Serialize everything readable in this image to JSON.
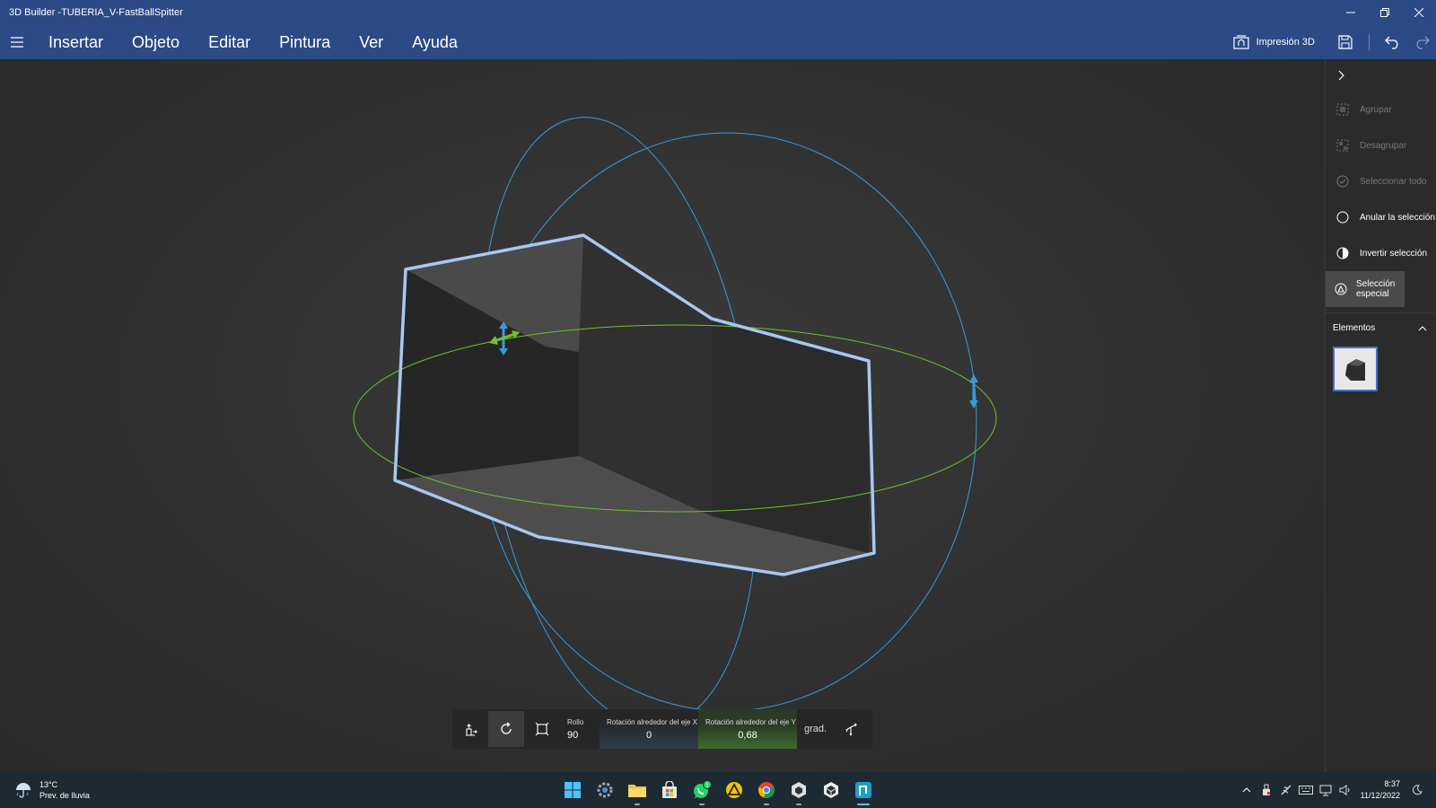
{
  "window": {
    "title": "3D Builder -TUBERIA_V-FastBallSpitter"
  },
  "menu": {
    "items": [
      {
        "label": "Insertar"
      },
      {
        "label": "Objeto"
      },
      {
        "label": "Editar"
      },
      {
        "label": "Pintura"
      },
      {
        "label": "Ver"
      },
      {
        "label": "Ayuda"
      }
    ],
    "print_label": "Impresión 3D"
  },
  "transform": {
    "fields": [
      {
        "label": "Rollo",
        "value": "90"
      },
      {
        "label": "Rotación alrededor del eje X",
        "value": "0"
      },
      {
        "label": "Rotación alrededor del eje Y",
        "value": "0,68"
      }
    ],
    "unit": "grad."
  },
  "panel": {
    "items": [
      {
        "label": "Agrupar",
        "enabled": false
      },
      {
        "label": "Desagrupar",
        "enabled": false
      },
      {
        "label": "Seleccionar todo",
        "enabled": false
      },
      {
        "label": "Anular la selección",
        "enabled": true
      },
      {
        "label": "Invertir selección",
        "enabled": true
      },
      {
        "label": "Selección especial",
        "enabled": true,
        "active": true
      }
    ],
    "elements_label": "Elementos"
  },
  "taskbar": {
    "weather_temp": "13°C",
    "weather_desc": "Prev. de lluvia",
    "time": "8:37",
    "date": "11/12/2022",
    "whatsapp_badge": "1"
  },
  "colors": {
    "title_bar": "#2b4a86",
    "selection_outline": "#a8c8f0",
    "gizmo_blue": "#3a9ad9",
    "gizmo_green": "#6ec22f"
  }
}
